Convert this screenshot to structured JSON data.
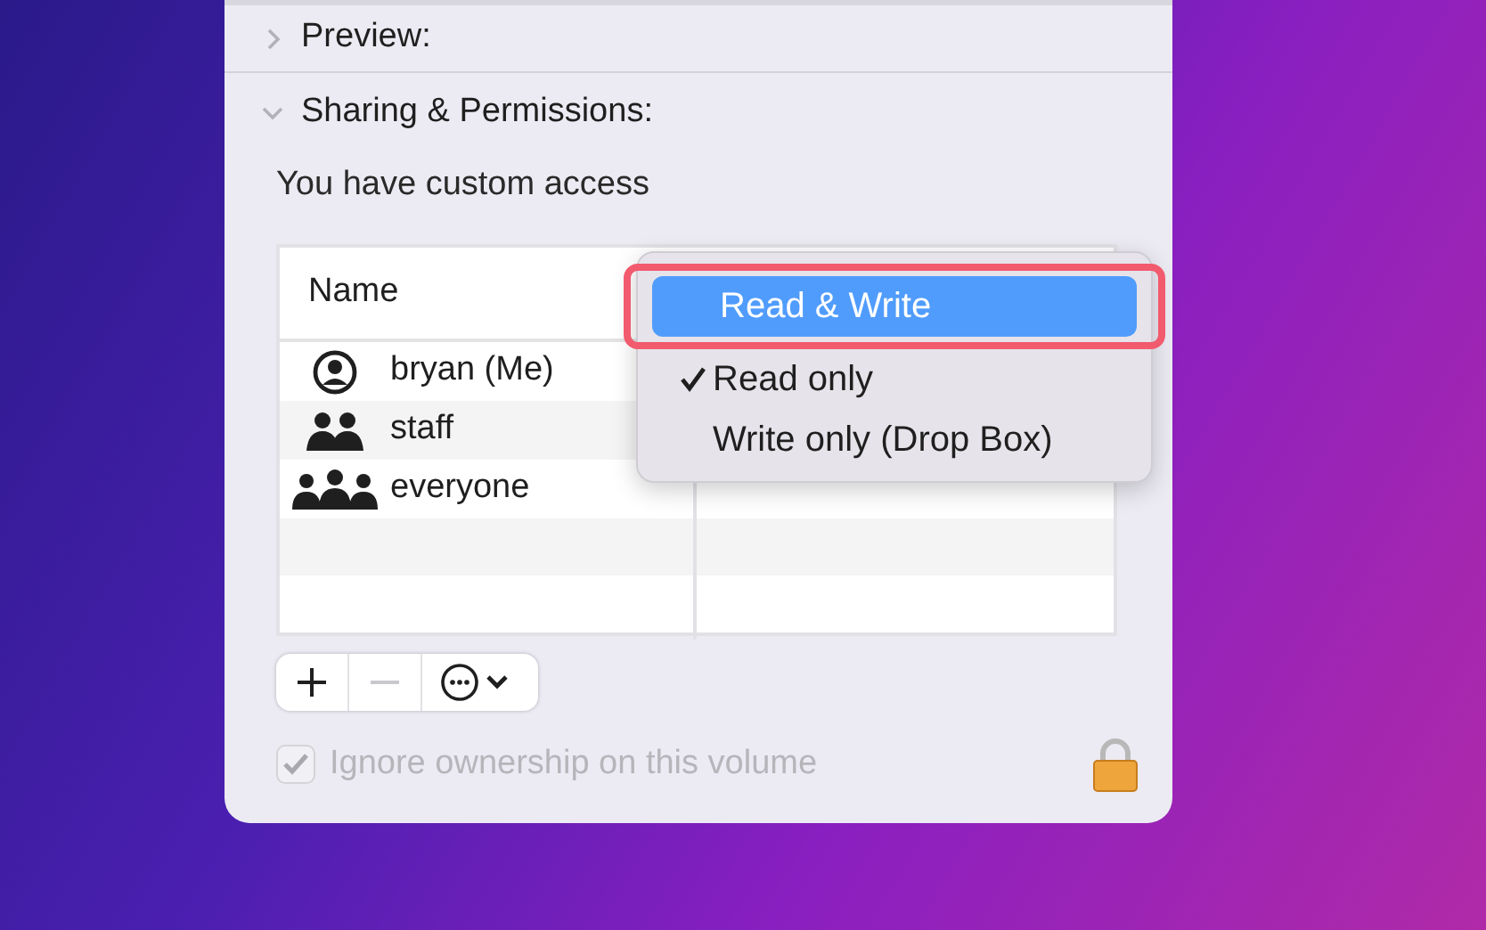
{
  "sections": [
    {
      "title": "Preview:",
      "expanded": false
    },
    {
      "title": "Sharing & Permissions:",
      "expanded": true
    }
  ],
  "access_note": "You have custom access",
  "table": {
    "columns": [
      "Name"
    ],
    "rows": [
      {
        "name": "bryan (Me)",
        "kind": "user"
      },
      {
        "name": "staff",
        "kind": "group"
      },
      {
        "name": "everyone",
        "kind": "everyone"
      }
    ]
  },
  "menu": {
    "items": [
      {
        "label": "Read & Write",
        "checked": false,
        "highlighted": true,
        "outlined": true
      },
      {
        "label": "Read only",
        "checked": true,
        "highlighted": false,
        "outlined": false
      },
      {
        "label": "Write only (Drop Box)",
        "checked": false,
        "highlighted": false,
        "outlined": false
      }
    ]
  },
  "toolbar": [
    {
      "kind": "add",
      "disabled": false
    },
    {
      "kind": "remove",
      "disabled": true
    },
    {
      "kind": "action",
      "disabled": false
    }
  ],
  "ignore_ownership": {
    "label": "Ignore ownership on this volume",
    "checked": true,
    "disabled": true
  }
}
